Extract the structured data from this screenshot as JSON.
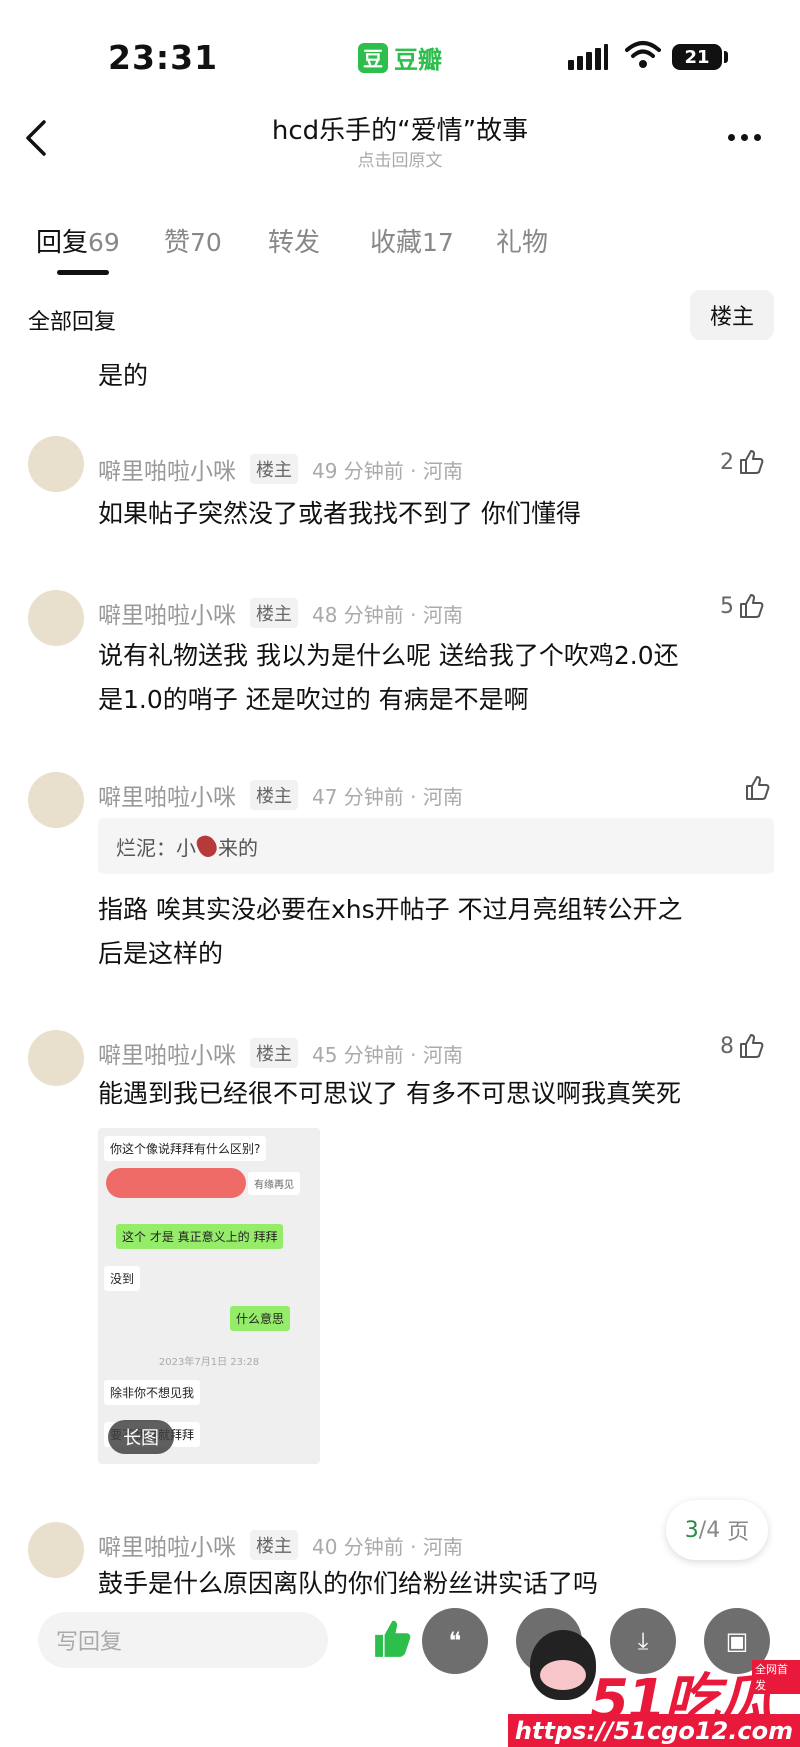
{
  "status_bar": {
    "time": "23:31",
    "app_badge": "豆",
    "app_name": "豆瓣",
    "battery": "21"
  },
  "nav": {
    "title": "hcd乐手的“爱情”故事",
    "subtitle": "点击回原文"
  },
  "tabs": [
    {
      "label": "回复",
      "count": "69"
    },
    {
      "label": "赞",
      "count": "70"
    },
    {
      "label": "转发",
      "count": ""
    },
    {
      "label": "收藏",
      "count": "17"
    },
    {
      "label": "礼物",
      "count": ""
    }
  ],
  "section": {
    "all_replies": "全部回复",
    "op_filter": "楼主"
  },
  "top_fragment": "是的",
  "comments": [
    {
      "name": "噼里啪啦小咪",
      "tag": "楼主",
      "meta": "49 分钟前 · 河南",
      "likes": "2",
      "text": "如果帖子突然没了或者我找不到了 你们懂得"
    },
    {
      "name": "噼里啪啦小咪",
      "tag": "楼主",
      "meta": "48 分钟前 · 河南",
      "likes": "5",
      "text_line1": "说有礼物送我 我以为是什么呢 送给我了个吹鸡2.0还",
      "text_line2": "是1.0的哨子 还是吹过的 有病是不是啊"
    },
    {
      "name": "噼里啪啦小咪",
      "tag": "楼主",
      "meta": "47 分钟前 · 河南",
      "likes": "",
      "quote_prefix": "烂泥：小",
      "quote_suffix": "来的",
      "text_line1": "指路 唉其实没必要在xhs开帖子 不过月亮组转公开之",
      "text_line2": "后是这样的"
    },
    {
      "name": "噼里啪啦小咪",
      "tag": "楼主",
      "meta": "45 分钟前 · 河南",
      "likes": "8",
      "text": "能遇到我已经很不可思议了 有多不可思议啊我真笑死"
    },
    {
      "name": "噼里啪啦小咪",
      "tag": "楼主",
      "meta": "40 分钟前 · 河南",
      "likes": "",
      "text": "鼓手是什么原因离队的你们给粉丝讲实话了吗"
    }
  ],
  "chat_image": {
    "msg1": "你这个像说拜拜有什么区别?",
    "msg2_tail": "有缘再见",
    "msg3": "这个 才是 真正意义上的 拜拜",
    "msg4": "没到",
    "msg5": "什么意思",
    "timestamp": "2023年7月1日 23:28",
    "msg6": "除非你不想见我",
    "msg7": "要不我说就拜拜",
    "badge": "长图"
  },
  "pagination": {
    "current": "3",
    "total": "/4",
    "unit": "页"
  },
  "bottom_bar": {
    "reply_placeholder": "写回复"
  },
  "watermark": {
    "logo": "51吃瓜",
    "tagline": "全网首发",
    "url": "https://51cgo12.com"
  },
  "colors": {
    "brand_green": "#2dbe4c",
    "watermark_red": "#e8193b"
  }
}
